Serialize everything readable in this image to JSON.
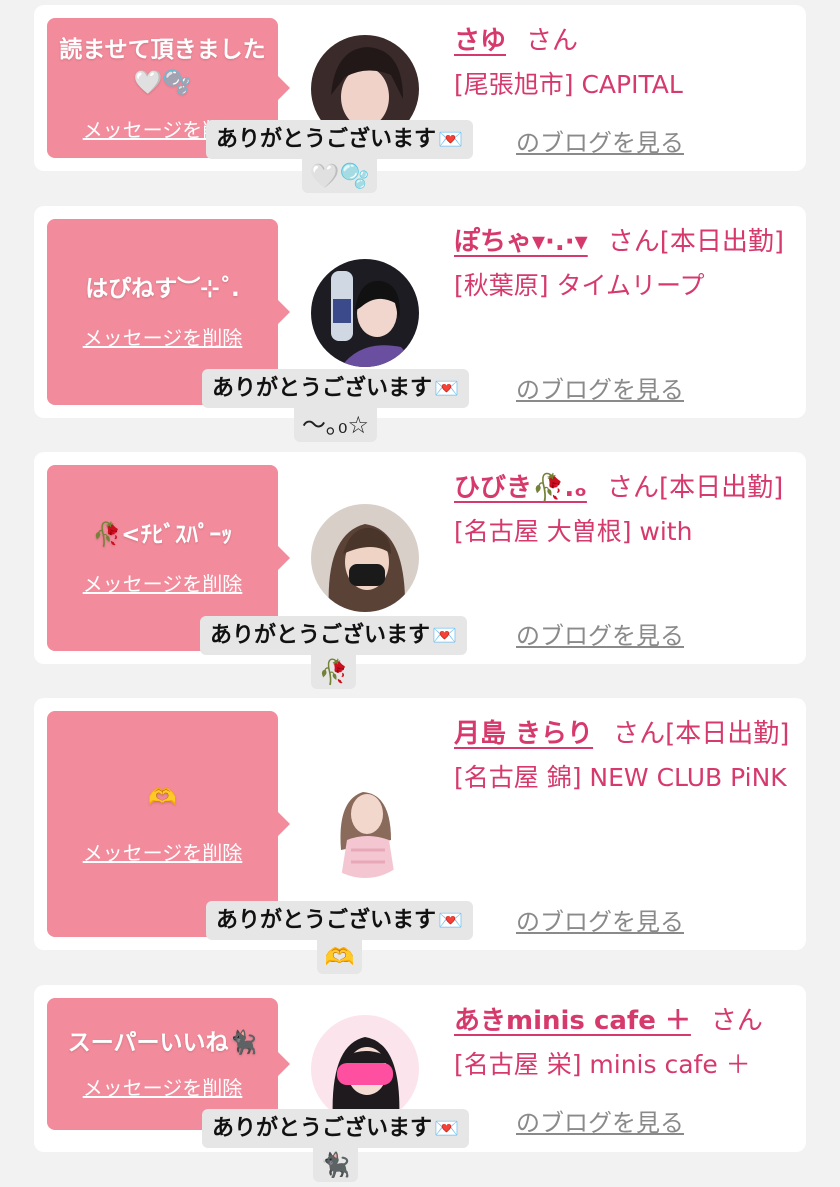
{
  "reaction_text": "ありがとうございます",
  "reaction_envelope_icon": "love-letter-icon",
  "delete_label": "メッセージを削除",
  "blog_label": "のブログを見る",
  "san": "さん",
  "colors": {
    "accent": "#d63a6c",
    "bubble": "#f28b9b",
    "background": "#f2f2f2"
  },
  "items": [
    {
      "message": "読ませて頂きました🤍🫧",
      "name": "さゆ",
      "suffix": "さん",
      "shop": "[尾張旭市] CAPITAL",
      "reaction_sub": "🤍🫧"
    },
    {
      "message": "はぴねす︶⊹˚.",
      "name": "ぽちゃ▾·.·▾",
      "suffix": "さん[本日出勤]",
      "shop": "[秋葉原] タイムリープ",
      "reaction_sub": "〜｡₀☆"
    },
    {
      "message": "🥀<ﾁﾋﾞｽﾊﾟｰｯ",
      "name": "ひびき🥀.ₒ",
      "suffix": "さん[本日出勤]",
      "shop": "[名古屋 大曽根] with",
      "reaction_sub": "🥀"
    },
    {
      "message": "🫶",
      "name": "月島 きらり",
      "suffix": "さん[本日出勤]",
      "shop": "[名古屋 錦] NEW CLUB PiNK",
      "reaction_sub": "🫶"
    },
    {
      "message": "スーパーいいね🐈‍⬛",
      "name": "あきminis cafe ＋",
      "suffix": "さん",
      "shop": "[名古屋 栄] minis cafe ＋",
      "reaction_sub": "🐈‍⬛"
    }
  ]
}
